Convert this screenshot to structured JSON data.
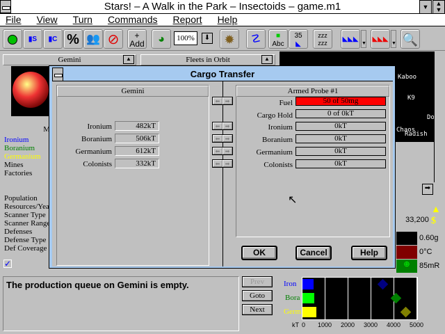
{
  "window": {
    "title": "Stars! – A Walk in the Park – Insectoids – game.m1"
  },
  "menu": [
    "File",
    "View",
    "Turn",
    "Commands",
    "Report",
    "Help"
  ],
  "toolbar": {
    "zoom": "100%",
    "add_label": "Add",
    "count_label": "35",
    "icons": [
      "planet-view-icon",
      "surface-minerals-icon",
      "concentrations-icon",
      "percent-icon",
      "population-icon",
      "no-info-icon",
      "add-waypoint-icon",
      "scanner-icon",
      "zoom-dropdown-icon",
      "minefield-icon",
      "paths-icon",
      "planet-names-icon",
      "ship-count-icon",
      "idle-fleets-icon",
      "friendly-fleets-icon",
      "enemy-fleets-icon",
      "find-icon"
    ]
  },
  "planet_panel": {
    "title": "Gemini",
    "minerals_header": "M",
    "mineral_labels": [
      "Ironium",
      "Boranium",
      "Germanium"
    ],
    "mines_labels": [
      "Mines",
      "Factories"
    ],
    "stats_labels": [
      "Population",
      "Resources/Year",
      "Scanner Type",
      "Scanner Range",
      "Defenses",
      "Defense Type",
      "Def Coverage"
    ]
  },
  "fleets_panel": {
    "title": "Fleets in Orbit"
  },
  "map": {
    "planets": [
      "Kaboo",
      "K9",
      "Do",
      "Chaos",
      "Radish"
    ]
  },
  "production": {
    "message": "The production queue on Gemini is empty.",
    "prev": "Prev",
    "goto": "Goto",
    "next": "Next"
  },
  "status_panel": {
    "value": "33,200",
    "gravity": "0.60g",
    "temperature": "0°C",
    "radiation": "85mR"
  },
  "mineral_chart": {
    "labels": [
      "Iron",
      "Bora",
      "Germ"
    ],
    "unit": "kT",
    "ticks": [
      "0",
      "1000",
      "2000",
      "3000",
      "4000",
      "5000"
    ],
    "surface": [
      482,
      506,
      612
    ],
    "concentration": [
      3500,
      4100,
      4500
    ],
    "colors": [
      "#0000ff",
      "#00ff00",
      "#ffff00"
    ]
  },
  "dialog": {
    "title": "Cargo Transfer",
    "left": {
      "title": "Gemini",
      "rows": [
        {
          "label": "Ironium",
          "value": "482kT"
        },
        {
          "label": "Boranium",
          "value": "506kT"
        },
        {
          "label": "Germanium",
          "value": "612kT"
        },
        {
          "label": "Colonists",
          "value": "332kT"
        }
      ]
    },
    "right": {
      "title": "Armed Probe #1",
      "fuel_label": "Fuel",
      "fuel": "50 of 50mg",
      "fuel_fraction": 1.0,
      "fuel_color": "#ff0000",
      "hold_label": "Cargo Hold",
      "hold": "0 of 0kT",
      "rows": [
        {
          "label": "Ironium",
          "value": "0kT"
        },
        {
          "label": "Boranium",
          "value": "0kT"
        },
        {
          "label": "Germanium",
          "value": "0kT"
        },
        {
          "label": "Colonists",
          "value": "0kT"
        }
      ]
    },
    "ok": "OK",
    "cancel": "Cancel",
    "help": "Help"
  }
}
